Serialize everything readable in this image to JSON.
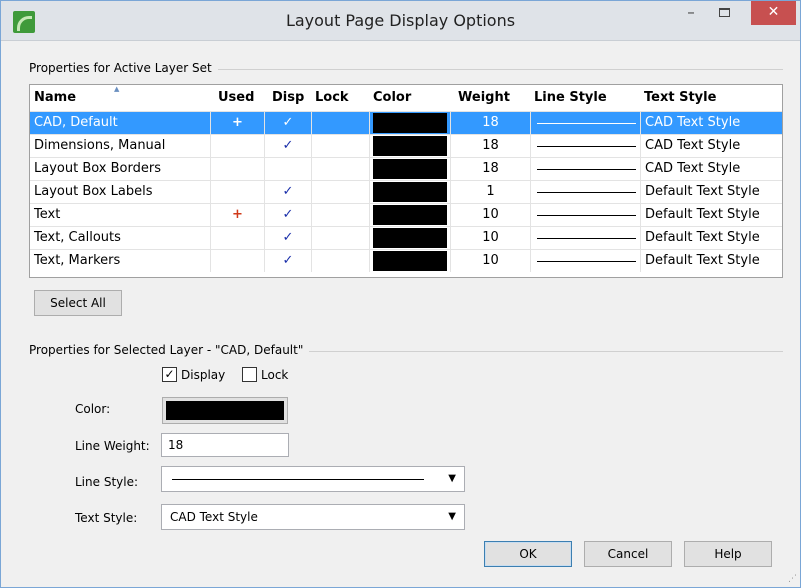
{
  "window": {
    "title": "Layout Page Display Options",
    "minimize_glyph": "–",
    "close_glyph": "✕"
  },
  "active_set": {
    "group_label": "Properties for Active Layer Set",
    "columns": {
      "name": "Name",
      "used": "Used",
      "disp": "Disp",
      "lock": "Lock",
      "color": "Color",
      "weight": "Weight",
      "line_style": "Line Style",
      "text_style": "Text Style"
    },
    "rows": [
      {
        "name": "CAD,  Default",
        "used": "+",
        "disp": "✓",
        "lock": "",
        "color": "#000000",
        "weight": "18",
        "text_style": "CAD Text Style"
      },
      {
        "name": "Dimensions,  Manual",
        "used": "",
        "disp": "✓",
        "lock": "",
        "color": "#000000",
        "weight": "18",
        "text_style": "CAD Text Style"
      },
      {
        "name": "Layout Box Borders",
        "used": "",
        "disp": "",
        "lock": "",
        "color": "#000000",
        "weight": "18",
        "text_style": "CAD Text Style"
      },
      {
        "name": "Layout Box Labels",
        "used": "",
        "disp": "✓",
        "lock": "",
        "color": "#000000",
        "weight": "1",
        "text_style": "Default Text Style"
      },
      {
        "name": "Text",
        "used": "+",
        "disp": "✓",
        "lock": "",
        "color": "#000000",
        "weight": "10",
        "text_style": "Default Text Style"
      },
      {
        "name": "Text,  Callouts",
        "used": "",
        "disp": "✓",
        "lock": "",
        "color": "#000000",
        "weight": "10",
        "text_style": "Default Text Style"
      },
      {
        "name": "Text,  Markers",
        "used": "",
        "disp": "✓",
        "lock": "",
        "color": "#000000",
        "weight": "10",
        "text_style": "Default Text Style"
      }
    ],
    "select_all_label": "Select All"
  },
  "selected_layer": {
    "group_label": "Properties for Selected Layer - \"CAD,  Default\"",
    "display_label": "Display",
    "display_checked": "✓",
    "lock_label": "Lock",
    "lock_checked": "",
    "color_label": "Color:",
    "color_value": "#000000",
    "line_weight_label": "Line Weight:",
    "line_weight_value": "18",
    "line_style_label": "Line Style:",
    "text_style_label": "Text Style:",
    "text_style_value": "CAD Text Style"
  },
  "buttons": {
    "ok": "OK",
    "cancel": "Cancel",
    "help": "Help"
  },
  "colors": {
    "selection": "#3399ff",
    "close_button": "#c75050",
    "used_marker": "#d03a1a",
    "check_marker": "#1a2faa"
  }
}
